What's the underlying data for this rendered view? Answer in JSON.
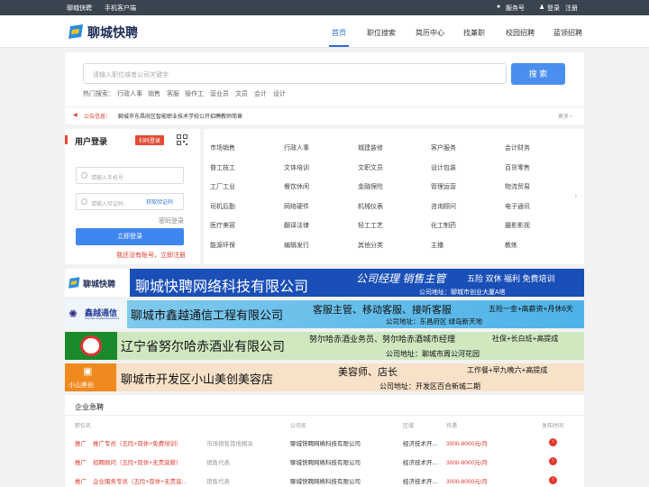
{
  "topbar": {
    "brand": "聊城快聘",
    "mobile": "手机客户端",
    "service": "服务号",
    "login": "登录",
    "register": "注册"
  },
  "logo": {
    "text": "聊城快聘"
  },
  "nav": [
    {
      "label": "首页"
    },
    {
      "label": "职位搜索"
    },
    {
      "label": "简历中心"
    },
    {
      "label": "找兼职"
    },
    {
      "label": "校园招聘"
    },
    {
      "label": "蓝领招聘"
    }
  ],
  "search": {
    "placeholder": "请输入职位或者公司关键字",
    "button": "搜 索",
    "hot_label": "热门搜索：",
    "hot": [
      "行政人事",
      "销售",
      "客服",
      "操作工",
      "营业员",
      "文员",
      "会计",
      "设计"
    ]
  },
  "notice": {
    "label": "公告信息：",
    "text": "聊城市东昌府区智能职业技术学校公开招聘教师简章",
    "more": "更多 ›"
  },
  "login": {
    "title": "用户登录",
    "scan_badge": "扫码登录",
    "phone_placeholder": "请输入手机号",
    "code_placeholder": "请输入验证码",
    "get_code": "获取验证码",
    "pwd_login": "密码登录",
    "submit": "立即登录",
    "forgot": "我还没有账号，立即注册"
  },
  "categories": [
    [
      "市场销售",
      "行政人事",
      "城建装修",
      "客户服务",
      "会计财务"
    ],
    [
      "普工技工",
      "文体培训",
      "文职文员",
      "设计包装",
      "百货零售"
    ],
    [
      "工厂工业",
      "餐饮休闲",
      "金融保险",
      "管理运营",
      "物流贸易"
    ],
    [
      "司机后勤",
      "网络硬件",
      "机械仪表",
      "咨询顾问",
      "电子通讯"
    ],
    [
      "医疗美容",
      "翻译法律",
      "轻工工艺",
      "化工制药",
      "摄影影视"
    ],
    [
      "能源环保",
      "编辑发行",
      "其他分类",
      "主播",
      "教练"
    ]
  ],
  "banners": [
    {
      "logo": "聊城快聘",
      "company": "聊城快聘网络科技有限公司",
      "jobs": "公司经理  销售主管",
      "benefits": "五险  双休  福利  免费培训",
      "address": "公司地址：聊城市创业大厦A塔"
    },
    {
      "logo": "鑫越通信",
      "logo_sub": "XINYUE COMMUNICATION",
      "company": "聊城市鑫越通信工程有限公司",
      "jobs": "客服主管、移动客服、接听客服",
      "benefits": "五险一金+高薪资+月休6天",
      "address": "公司地址：东昌府区 绿岛新天地"
    },
    {
      "company": "辽宁省努尔哈赤酒业有限公司",
      "jobs": "努尔哈赤酒业务员、努尔哈赤酒城市经理",
      "benefits": "社保+长白班+高提成",
      "address": "公司地址：聊城市周公河花园"
    },
    {
      "logo": "小山美创",
      "company": "聊城市开发区小山美创美容店",
      "jobs": "美容师、店长",
      "benefits": "工作餐+早九晚六+高提成",
      "address": "公司地址：开发区百合新城二期"
    }
  ],
  "jobs_section": {
    "title": "企业急聘",
    "headers": [
      "职位名",
      "公司名",
      "区域",
      "待遇",
      "发布时间"
    ],
    "rows": [
      {
        "tag": "推广",
        "title": "推广专员（五险+双休+免费培训）",
        "cat": "市场销售其他相关",
        "company": "聊城快聘网络科技有限公司",
        "area": "经济技术开...",
        "salary": "3000-8000元/月"
      },
      {
        "tag": "推广",
        "title": "招聘顾问（五险+双休+无责底薪）",
        "cat": "销售代表",
        "company": "聊城快聘网络科技有限公司",
        "area": "经济技术开...",
        "salary": "3000-8000元/月"
      },
      {
        "tag": "推广",
        "title": "企业服务专员（五险+双休+无责底...",
        "cat": "销售代表",
        "company": "聊城快聘网络科技有限公司",
        "area": "经济技术开...",
        "salary": "3000-8000元/月"
      }
    ]
  },
  "colors": {
    "accent": "#2b6bd4",
    "button": "#4a8ef0",
    "red": "#e03b2e"
  }
}
